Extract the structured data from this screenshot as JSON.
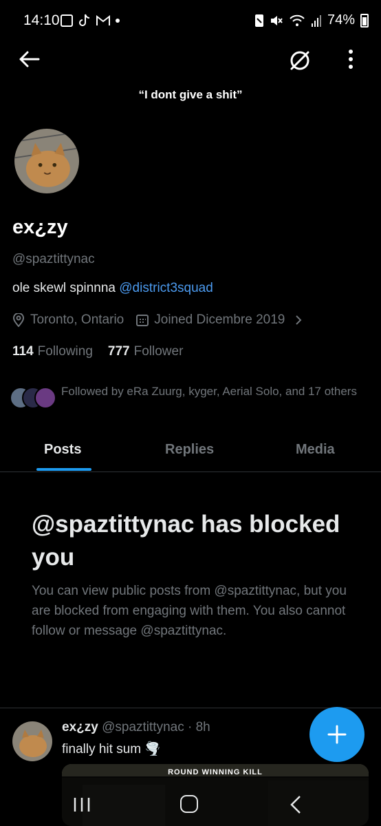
{
  "status_bar": {
    "time": "14:10",
    "battery": "74%",
    "icons": [
      "gallery-icon",
      "tiktok-icon",
      "gmail-icon",
      "notification-dot",
      "nfc-icon",
      "mute-icon",
      "wifi-icon",
      "signal-icon",
      "battery-icon"
    ]
  },
  "nav": {
    "back_icon": "arrow-left-icon",
    "noosr_icon": "no-symbol-icon",
    "more_icon": "vertical-dots-icon"
  },
  "profile": {
    "quote": "“I dont give a shit”",
    "display_name": "ex¿zy",
    "handle": "@spaztittynac",
    "bio_text": "ole skewl spinnna ",
    "bio_link": "@district3squad",
    "location": "Toronto, Ontario",
    "joined": "Joined Dicembre 2019",
    "following_count": "114",
    "following_label": "Following",
    "follower_count": "777",
    "follower_label": "Follower",
    "followed_by": "Followed by eRa Zuurg, kyger, Aerial Solo, and 17 others"
  },
  "tabs": [
    {
      "label": "Posts",
      "active": true
    },
    {
      "label": "Replies",
      "active": false
    },
    {
      "label": "Media",
      "active": false
    }
  ],
  "blocked": {
    "title": "@spaztittynac has blocked you",
    "body": "You can view public posts from @spaztittynac, but you are blocked from engaging with them. You also cannot follow or message @spaztittynac."
  },
  "post": {
    "author_name": "ex¿zy",
    "author_handle": "@spaztittynac",
    "time": "· 8h",
    "text": "finally hit sum 🌪️",
    "media_caption": "ROUND WINNING KILL"
  },
  "fab": {
    "icon": "plus-icon"
  },
  "colors": {
    "background": "#000000",
    "text_primary": "#e7e9ea",
    "text_secondary": "#71767b",
    "accent": "#1d9bf0",
    "link": "#4c9bf0"
  }
}
